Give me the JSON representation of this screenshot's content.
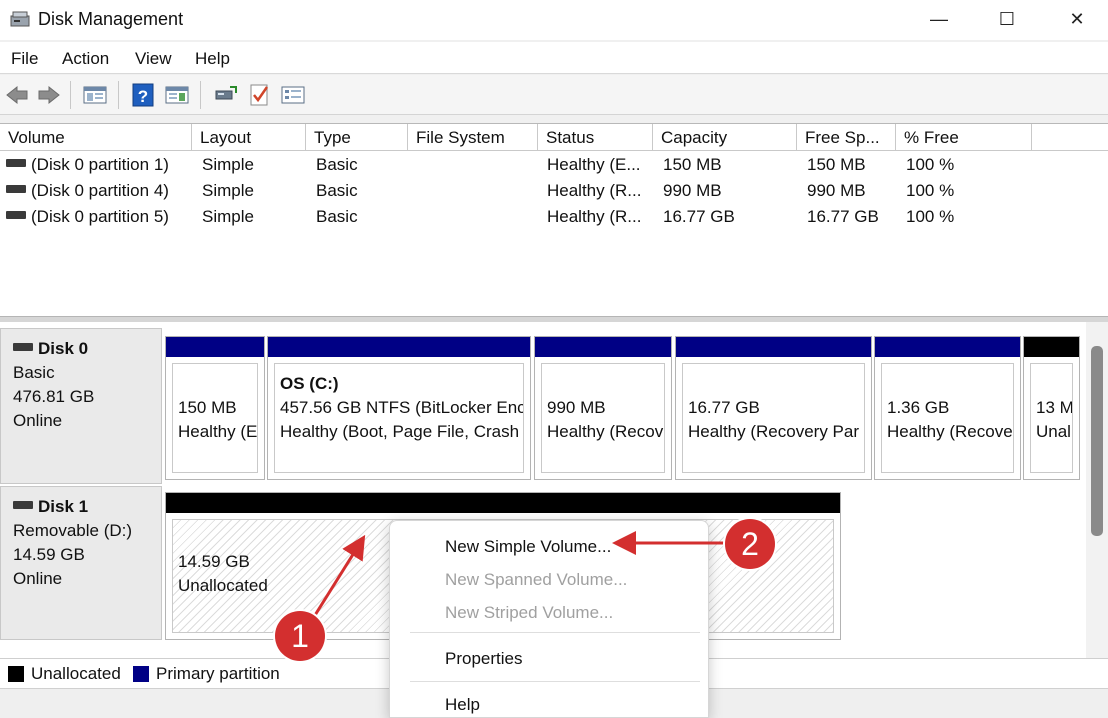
{
  "window": {
    "title": "Disk Management"
  },
  "window_controls": {
    "minimize": "—",
    "maximize": "☐",
    "close": "✕"
  },
  "menu": [
    "File",
    "Action",
    "View",
    "Help"
  ],
  "toolbar_icons": [
    "back-arrow-icon",
    "forward-arrow-icon",
    "console-tree-icon",
    "help-icon",
    "properties-icon",
    "connect-icon",
    "check-icon",
    "settings-icon"
  ],
  "volume_table": {
    "headers": [
      "Volume",
      "Layout",
      "Type",
      "File System",
      "Status",
      "Capacity",
      "Free Sp...",
      "% Free"
    ],
    "rows": [
      {
        "volume": "(Disk 0 partition 1)",
        "layout": "Simple",
        "type": "Basic",
        "fs": "",
        "status": "Healthy (E...",
        "capacity": "150 MB",
        "free": "150 MB",
        "pct": "100 %"
      },
      {
        "volume": "(Disk 0 partition 4)",
        "layout": "Simple",
        "type": "Basic",
        "fs": "",
        "status": "Healthy (R...",
        "capacity": "990 MB",
        "free": "990 MB",
        "pct": "100 %"
      },
      {
        "volume": "(Disk 0 partition 5)",
        "layout": "Simple",
        "type": "Basic",
        "fs": "",
        "status": "Healthy (R...",
        "capacity": "16.77 GB",
        "free": "16.77 GB",
        "pct": "100 %"
      }
    ]
  },
  "disks": [
    {
      "name": "Disk 0",
      "kind": "Basic",
      "size": "476.81 GB",
      "state": "Online",
      "partitions": [
        {
          "title": "",
          "l1": "150 MB",
          "l2": "Healthy (E"
        },
        {
          "title": "OS  (C:)",
          "l1": "457.56 GB NTFS (BitLocker Enc",
          "l2": "Healthy (Boot, Page File, Crash"
        },
        {
          "title": "",
          "l1": "990 MB",
          "l2": "Healthy (Recov"
        },
        {
          "title": "",
          "l1": "16.77 GB",
          "l2": "Healthy (Recovery Par"
        },
        {
          "title": "",
          "l1": "1.36 GB",
          "l2": "Healthy (Recove"
        },
        {
          "title": "",
          "l1": "13 M",
          "l2": "Unal"
        }
      ]
    },
    {
      "name": "Disk 1",
      "kind": "Removable (D:)",
      "size": "14.59 GB",
      "state": "Online",
      "partitions": [
        {
          "title": "",
          "l1": "14.59 GB",
          "l2": "Unallocated"
        }
      ]
    }
  ],
  "legend": [
    {
      "label": "Unallocated",
      "color": "#000000"
    },
    {
      "label": "Primary partition",
      "color": "#000085"
    }
  ],
  "context_menu": {
    "items": [
      {
        "label": "New Simple Volume...",
        "enabled": true
      },
      {
        "label": "New Spanned Volume...",
        "enabled": false
      },
      {
        "label": "New Striped Volume...",
        "enabled": false
      },
      {
        "label": "Properties",
        "enabled": true
      },
      {
        "label": "Help",
        "enabled": true
      }
    ]
  },
  "annotations": {
    "step1": "1",
    "step2": "2",
    "color": "#d32f2f"
  }
}
